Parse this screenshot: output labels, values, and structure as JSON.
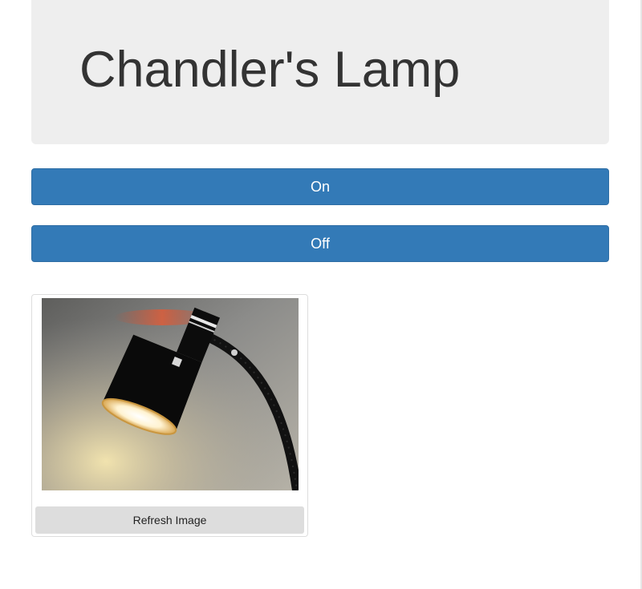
{
  "header": {
    "title": "Chandler's Lamp"
  },
  "controls": {
    "on_label": "On",
    "off_label": "Off"
  },
  "camera": {
    "image_subject": "desk-lamp-camera-snapshot",
    "refresh_label": "Refresh Image"
  },
  "colors": {
    "primary": "#337ab7",
    "jumbotron": "#eeeeee"
  }
}
